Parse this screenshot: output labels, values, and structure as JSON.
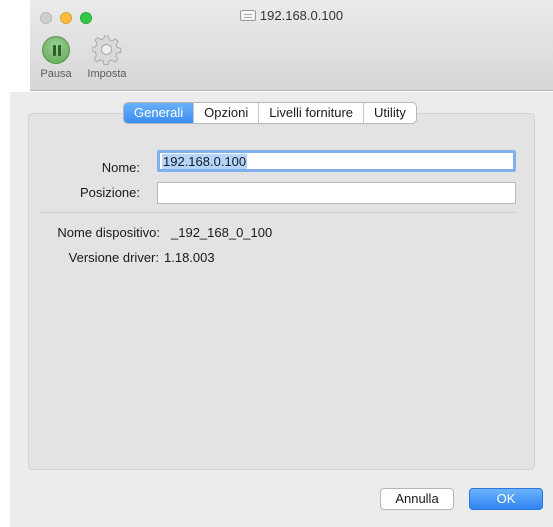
{
  "window": {
    "title": "192.168.0.100"
  },
  "toolbar": {
    "pause_label": "Pausa",
    "setup_label": "Imposta"
  },
  "tabs": [
    {
      "label": "Generali",
      "active": true
    },
    {
      "label": "Opzioni",
      "active": false
    },
    {
      "label": "Livelli forniture",
      "active": false
    },
    {
      "label": "Utility",
      "active": false
    }
  ],
  "form": {
    "name_label": "Nome:",
    "name_value": "192.168.0.100",
    "position_label": "Posizione:",
    "position_value": ""
  },
  "info": {
    "device_name_label": "Nome dispositivo:",
    "device_name_value": "_192_168_0_100",
    "driver_version_label": "Versione driver:",
    "driver_version_value": "1.18.003"
  },
  "buttons": {
    "cancel_label": "Annulla",
    "ok_label": "OK"
  },
  "colors": {
    "accent": "#3b8df2",
    "pause_green": "#5fa653"
  }
}
